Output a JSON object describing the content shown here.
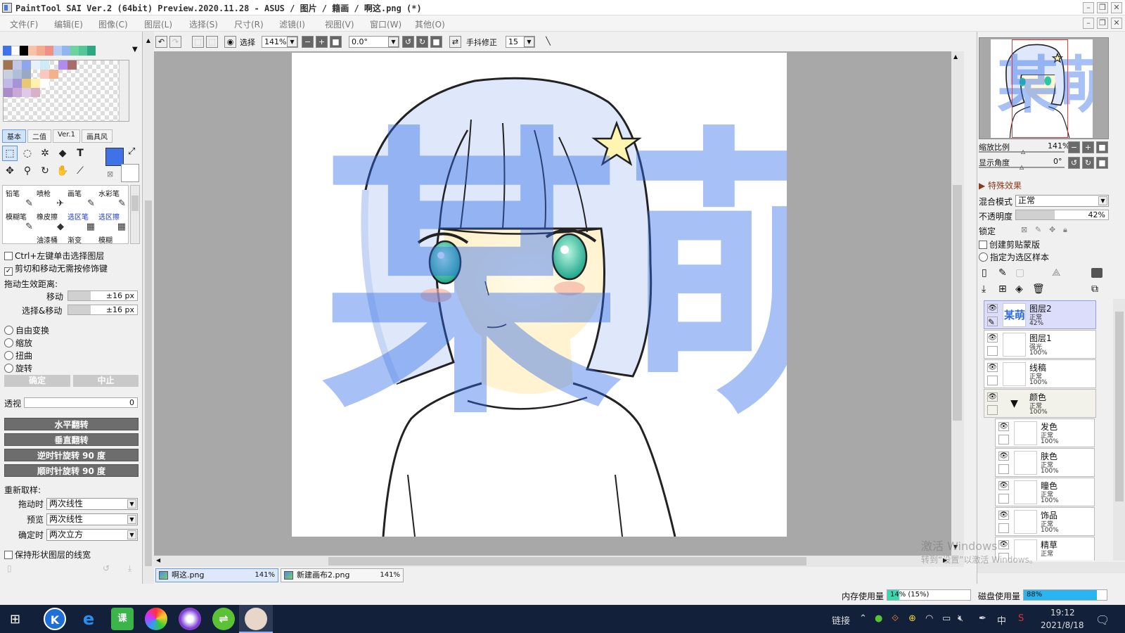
{
  "window": {
    "title": "PaintTool SAI Ver.2 (64bit) Preview.2020.11.28 - ASUS / 图片 / 籍画 / 啊这.png (*)"
  },
  "menu": [
    "文件(F)",
    "编辑(E)",
    "图像(C)",
    "图层(L)",
    "选择(S)",
    "尺寸(R)",
    "滤镜(I)",
    "视图(V)",
    "窗口(W)",
    "其他(O)"
  ],
  "colors": {
    "swatches": [
      "#3f72e8",
      "#ffffff",
      "#000000",
      "#f7c2a8",
      "#f5a98f",
      "#f08f86",
      "#b8cdf4",
      "#8fb6ef",
      "#6cd39e",
      "#52c79a",
      "#2ea883"
    ],
    "foreground": "#3f72e8",
    "background": "#ffffff",
    "accent": "#cfe3fb"
  },
  "left": {
    "tabs": [
      "基本",
      "二值",
      "Ver.1",
      "画具风"
    ],
    "brushes": [
      {
        "name": "铅笔",
        "icon": "✎"
      },
      {
        "name": "喷枪",
        "icon": "✈"
      },
      {
        "name": "画笔",
        "icon": "✎"
      },
      {
        "name": "水彩笔",
        "icon": "✎"
      },
      {
        "name": "模糊笔",
        "icon": "✎"
      },
      {
        "name": "橡皮擦",
        "icon": "◆"
      },
      {
        "name": "选区笔",
        "icon": "▦"
      },
      {
        "name": "选区擦",
        "icon": "▦"
      },
      {
        "name": "",
        "icon": ""
      },
      {
        "name": "油漆桶",
        "icon": ""
      },
      {
        "name": "渐变",
        "icon": ""
      },
      {
        "name": "模糊",
        "icon": ""
      }
    ],
    "ctrl_click": "Ctrl+左键单击选择图层",
    "cut_move": "剪切和移动无需按修饰键",
    "drag_dist_label": "拖动生效距离:",
    "move_label": "移动",
    "move_value": "±16 px",
    "selmove_label": "选择&移动",
    "selmove_value": "±16 px",
    "transforms": [
      "自由变换",
      "缩放",
      "扭曲",
      "旋转"
    ],
    "ok": "确定",
    "cancel": "中止",
    "perspective_label": "透视",
    "perspective_value": "0",
    "flip_h": "水平翻转",
    "flip_v": "垂直翻转",
    "rot_ccw": "逆时针旋转 90 度",
    "rot_cw": "顺时针旋转 90 度",
    "resample_label": "重新取样:",
    "drag_label": "拖动时",
    "drag_value": "两次线性",
    "preview_label": "预览",
    "preview_value": "两次线性",
    "confirm_label": "确定时",
    "confirm_value": "两次立方",
    "keep_stroke": "保持形状图层的线宽"
  },
  "toolbar": {
    "select_label": "选择",
    "zoom": "141%",
    "angle": "0.0°",
    "stabilizer_label": "手抖修正",
    "stabilizer_value": "15"
  },
  "canvas": {
    "watermark": "某萌"
  },
  "doc_tabs": [
    {
      "name": "啊这.png",
      "zoom": "141%",
      "active": true
    },
    {
      "name": "新建画布2.png",
      "zoom": "141%",
      "active": false
    }
  ],
  "right": {
    "zoom_label": "缩放比例",
    "zoom_value": "141%",
    "angle_label": "显示角度",
    "angle_value": "0°",
    "effects_label": "特殊效果",
    "blend_label": "混合模式",
    "blend_value": "正常",
    "opacity_label": "不透明度",
    "opacity_value": "42%",
    "opacity_level": 0.42,
    "lock_label": "锁定",
    "clip_label": "创建剪贴蒙版",
    "sample_label": "指定为选区样本",
    "layers": [
      {
        "name": "图层2",
        "mode": "正常",
        "opacity": "42%",
        "active": true,
        "indent": false
      },
      {
        "name": "图层1",
        "mode": "强光",
        "opacity": "100%",
        "active": false,
        "indent": false
      },
      {
        "name": "线稿",
        "mode": "正常",
        "opacity": "100%",
        "active": false,
        "indent": false
      },
      {
        "name": "颜色",
        "mode": "正常",
        "opacity": "100%",
        "active": false,
        "indent": false,
        "folder": true
      },
      {
        "name": "发色",
        "mode": "正常",
        "opacity": "100%",
        "active": false,
        "indent": true
      },
      {
        "name": "肤色",
        "mode": "正常",
        "opacity": "100%",
        "active": false,
        "indent": true
      },
      {
        "name": "瞳色",
        "mode": "正常",
        "opacity": "100%",
        "active": false,
        "indent": true
      },
      {
        "name": "饰品",
        "mode": "正常",
        "opacity": "100%",
        "active": false,
        "indent": true
      },
      {
        "name": "精草",
        "mode": "正常",
        "opacity": "",
        "active": false,
        "indent": true
      }
    ]
  },
  "status": {
    "mem_label": "内存使用量",
    "mem_value": "14% (15%)",
    "mem_level": 0.14,
    "disk_label": "磁盘使用量",
    "disk_value": "88%",
    "disk_level": 0.88,
    "activation1": "激活 Windows",
    "activation2": "转到“设置”以激活 Windows。"
  },
  "taskbar": {
    "tray_link": "链接",
    "ime": "中",
    "time": "19:12",
    "date": "2021/8/18"
  }
}
